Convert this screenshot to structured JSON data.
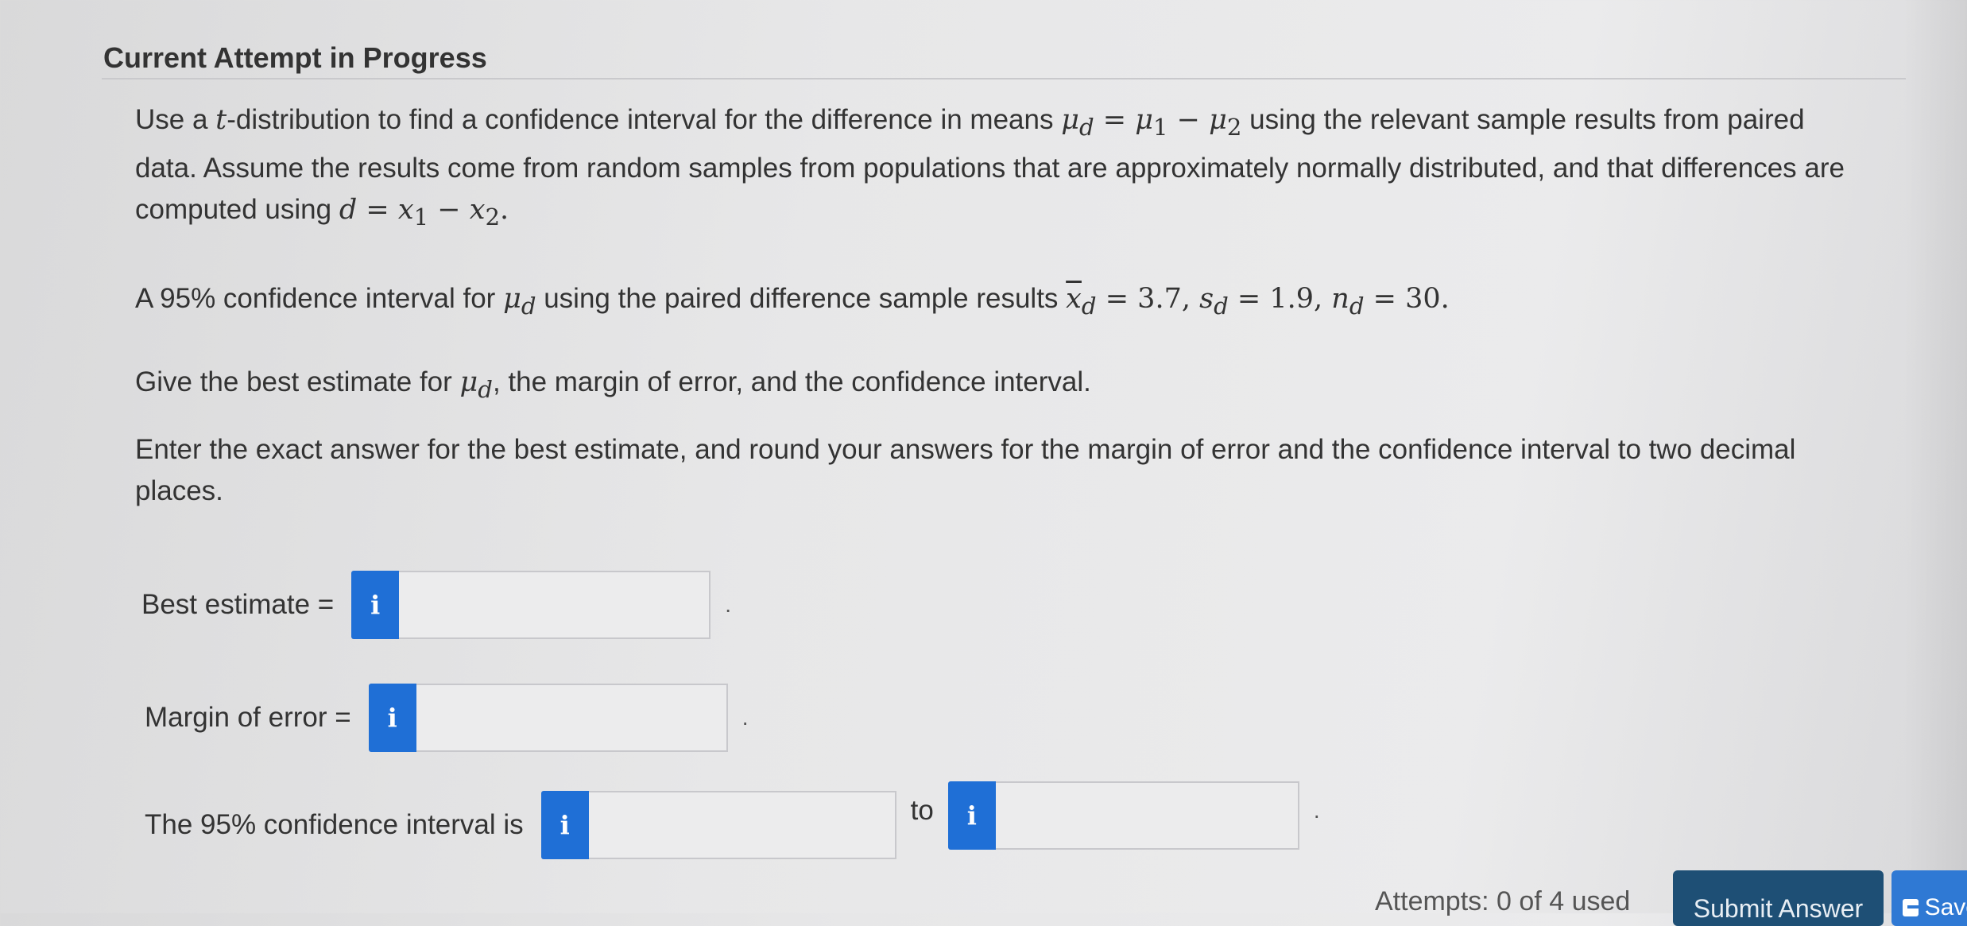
{
  "header": {
    "title": "Current Attempt in Progress"
  },
  "question": {
    "intro_pre": "Use a ",
    "intro_t": "t",
    "intro_mid": "-distribution to find a confidence interval for the difference in means ",
    "mu_d_eq": "μ",
    "intro_post": " using the relevant sample results from paired data. Assume the results come from random samples from populations that are approximately normally distributed, and that differences are computed using ",
    "para2_pre": "A 95% confidence interval for ",
    "para2_mid": " using the paired difference sample results ",
    "para3_pre": "Give the best estimate for ",
    "para3_post": ", the margin of error, and the confidence interval.",
    "para4": "Enter the exact answer for the best estimate, and round your answers for the margin of error and the confidence interval to two decimal places."
  },
  "answers": {
    "best_estimate_label": "Best estimate =",
    "margin_label": "Margin of error =",
    "ci_label": "The 95% confidence interval is",
    "to_label": "to",
    "info_glyph": "i",
    "end_dot": ".",
    "best_estimate_value": "",
    "margin_value": "",
    "ci_low_value": "",
    "ci_high_value": ""
  },
  "footer": {
    "attempts_text": "Attempts: 0 of 4 used",
    "submit_label": "Submit Answer",
    "save_label": "Save"
  }
}
